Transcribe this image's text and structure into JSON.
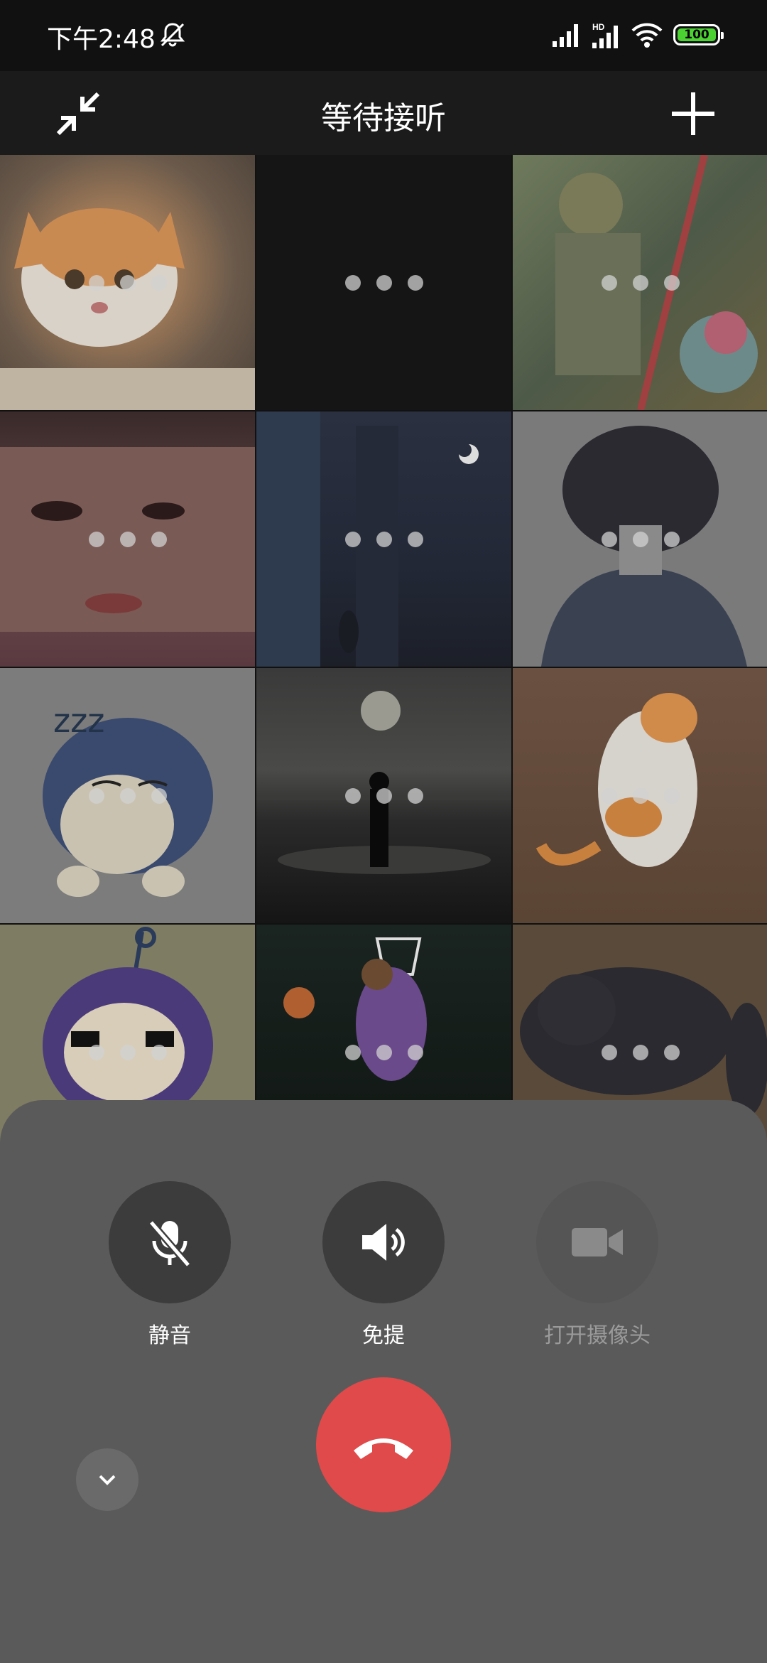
{
  "status": {
    "time": "下午2:48",
    "battery": "100",
    "hd": "HD"
  },
  "header": {
    "title": "等待接听"
  },
  "participants": [
    {
      "name": "cat-orange-white"
    },
    {
      "name": "empty-dark"
    },
    {
      "name": "anime-pirate"
    },
    {
      "name": "woman-portrait"
    },
    {
      "name": "night-window-cat"
    },
    {
      "name": "anime-boy-hair"
    },
    {
      "name": "snorlax-cartoon"
    },
    {
      "name": "beach-silhouette"
    },
    {
      "name": "cat-on-floor"
    },
    {
      "name": "teletubby-cartoon"
    },
    {
      "name": "basketball-dunk"
    },
    {
      "name": "grey-cat"
    }
  ],
  "controls": {
    "mute": "静音",
    "speaker": "免提",
    "camera": "打开摄像头"
  },
  "colors": {
    "hangup": "#e04a4a",
    "battery": "#4bd131",
    "panel": "#5a5a5a"
  }
}
